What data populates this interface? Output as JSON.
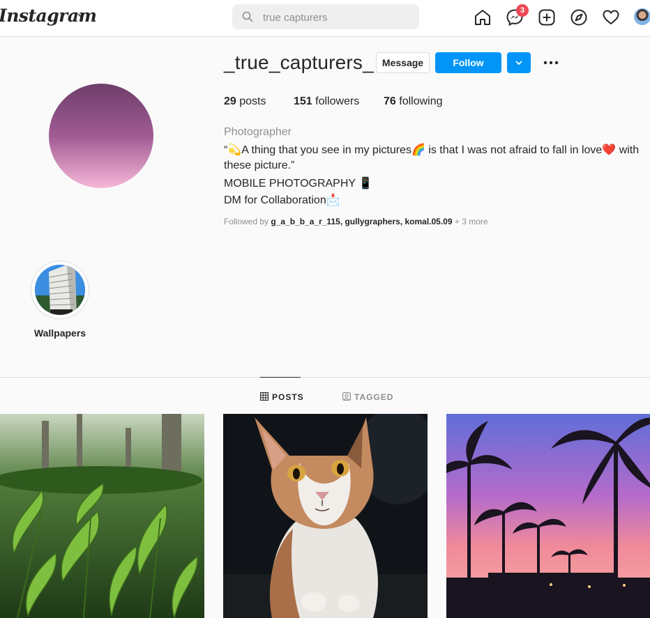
{
  "nav": {
    "logo": "Instagram",
    "search_placeholder": "true capturers",
    "messenger_badge": "3"
  },
  "profile": {
    "username": "_true_capturers_",
    "message_label": "Message",
    "follow_label": "Follow",
    "stats": [
      {
        "count": "29",
        "label": "posts"
      },
      {
        "count": "151",
        "label": "followers"
      },
      {
        "count": "76",
        "label": "following"
      }
    ],
    "category": "Photographer",
    "bio": [
      "“💫A thing that you see in my pictures🌈 is that I was not afraid to fall in love❤️ with",
      "these picture.”",
      "MOBILE PHOTOGRAPHY 📱",
      "DM for Collaboration📩"
    ],
    "followed_by_prefix": "Followed by",
    "followed_by_names": "g_a_b_b_a_r_115, gullygraphers, komal.05.09",
    "followed_by_more": "+ 3 more"
  },
  "highlights": [
    {
      "label": "Wallpapers"
    }
  ],
  "tabs": [
    {
      "label": "POSTS",
      "active": true
    },
    {
      "label": "TAGGED",
      "active": false
    }
  ],
  "posts": [
    {
      "subject": "tea leaves"
    },
    {
      "subject": "calico cat"
    },
    {
      "subject": "palm trees at sunset"
    }
  ],
  "colors": {
    "accent": "#0095f6",
    "badge": "#ed4956"
  }
}
